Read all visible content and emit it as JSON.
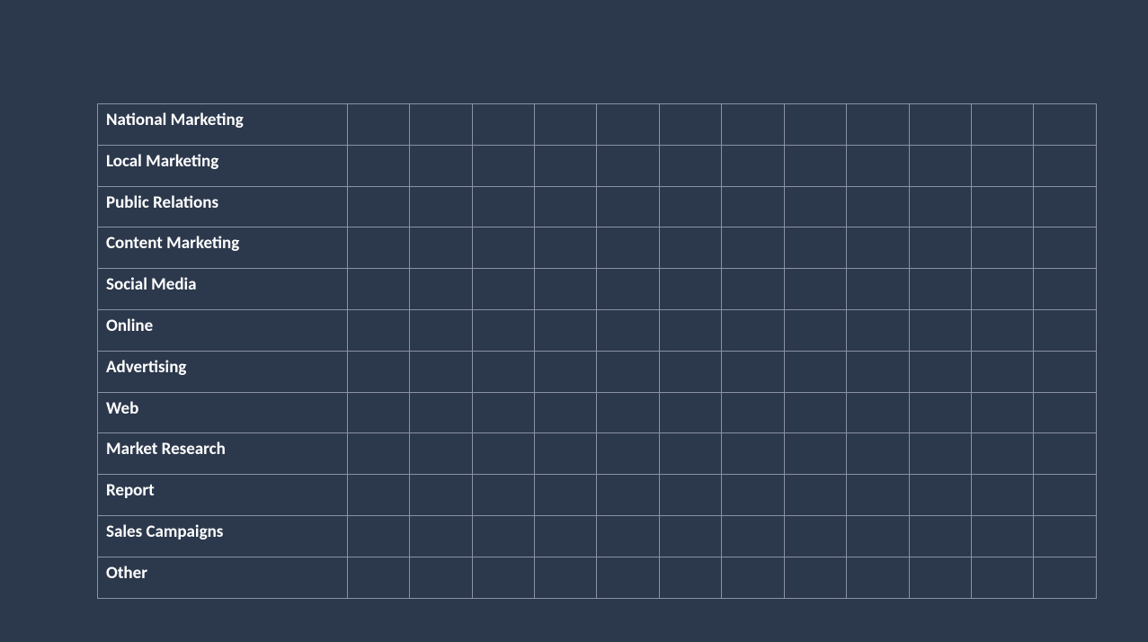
{
  "colors": {
    "background": "#2c384c",
    "border": "#8a92a3",
    "text": "#ffffff"
  },
  "table": {
    "columns": 12,
    "rows": [
      {
        "label": "National Marketing"
      },
      {
        "label": "Local Marketing"
      },
      {
        "label": "Public Relations"
      },
      {
        "label": "Content Marketing"
      },
      {
        "label": "Social Media"
      },
      {
        "label": "Online"
      },
      {
        "label": "Advertising"
      },
      {
        "label": "Web"
      },
      {
        "label": "Market Research"
      },
      {
        "label": "Report"
      },
      {
        "label": "Sales Campaigns"
      },
      {
        "label": "Other"
      }
    ]
  }
}
